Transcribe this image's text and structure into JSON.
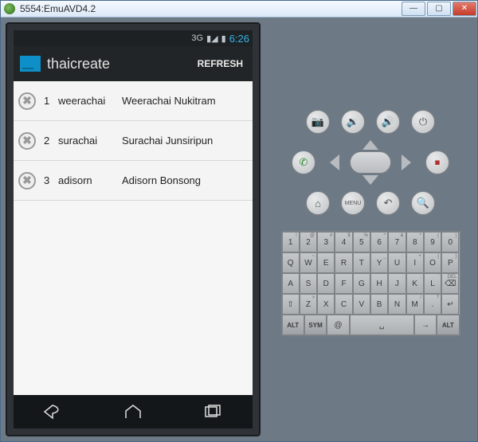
{
  "window": {
    "title": "5554:EmuAVD4.2",
    "min_label": "—",
    "max_label": "▢",
    "close_label": "✕"
  },
  "statusbar": {
    "threeg": "3G",
    "signal": "▮◢",
    "battery": "▮",
    "time": "6:26"
  },
  "appbar": {
    "title": "thaicreate",
    "refresh": "REFRESH"
  },
  "rows": [
    {
      "num": "1",
      "username": "weerachai",
      "fullname": "Weerachai Nukitram"
    },
    {
      "num": "2",
      "username": "surachai",
      "fullname": "Surachai Junsiripun"
    },
    {
      "num": "3",
      "username": "adisorn",
      "fullname": "Adisorn Bonsong"
    }
  ],
  "delete_glyph": "✖",
  "hw": {
    "camera": "📷",
    "vol_down": "🔉",
    "vol_up": "🔊",
    "power": "⏻",
    "call": "✆",
    "end": "⏹",
    "home": "⌂",
    "menu": "MENU",
    "back": "↶",
    "search": "🔍"
  },
  "keyboard": {
    "r1_sup": [
      "!",
      "@",
      "#",
      "$",
      "%",
      "^",
      "&",
      "*",
      "(",
      ")"
    ],
    "r1": [
      "1",
      "2",
      "3",
      "4",
      "5",
      "6",
      "7",
      "8",
      "9",
      "0"
    ],
    "r2_sup": [
      "",
      "~",
      "",
      "",
      "",
      "_",
      "-",
      "+",
      "{",
      "}"
    ],
    "r2": [
      "Q",
      "W",
      "E",
      "R",
      "T",
      "Y",
      "U",
      "I",
      "O",
      "P"
    ],
    "r3_sup": [
      "",
      "",
      "",
      "",
      "",
      "",
      ":",
      ";",
      "'",
      "DEL"
    ],
    "r3": [
      "A",
      "S",
      "D",
      "F",
      "G",
      "H",
      "J",
      "K",
      "L",
      "⌫"
    ],
    "r4_sup": [
      "",
      ">",
      "",
      "",
      "",
      "",
      "",
      "/",
      "?",
      ""
    ],
    "r4": [
      "⇧",
      "Z",
      "X",
      "C",
      "V",
      "B",
      "N",
      "M",
      ".",
      "↵"
    ],
    "r5": [
      "ALT",
      "SYM",
      "@",
      "␣",
      "→",
      "ALT"
    ]
  }
}
